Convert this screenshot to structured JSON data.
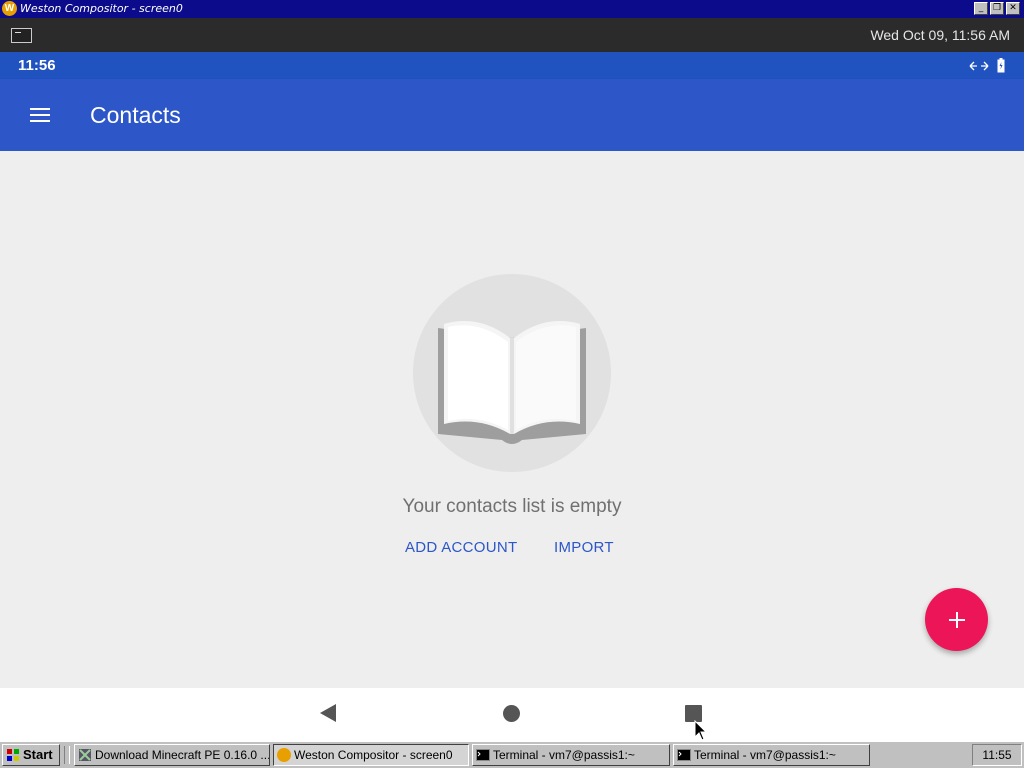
{
  "window": {
    "title": "Weston Compositor - screen0",
    "controls": {
      "minimize": "_",
      "restore": "❐",
      "close": "✕"
    }
  },
  "weston": {
    "clock": "Wed Oct 09, 11:56 AM"
  },
  "status_bar": {
    "time": "11:56"
  },
  "app_bar": {
    "title": "Contacts"
  },
  "content": {
    "empty_message": "Your contacts list is empty",
    "add_account_label": "ADD ACCOUNT",
    "import_label": "IMPORT"
  },
  "taskbar": {
    "start_label": "Start",
    "items": [
      {
        "label": "Download Minecraft PE 0.16.0 ..."
      },
      {
        "label": "Weston Compositor - screen0"
      },
      {
        "label": "Terminal - vm7@passis1:~"
      },
      {
        "label": "Terminal - vm7@passis1:~"
      }
    ],
    "clock": "11:55"
  },
  "colors": {
    "status_bar": "#2052c0",
    "app_bar": "#2d57c8",
    "fab": "#ec1558",
    "accent": "#2d57c8"
  },
  "icons": [
    "weston-icon",
    "terminal-icon",
    "sync-icon",
    "battery-icon",
    "menu-icon",
    "book-icon",
    "plus-icon",
    "back-icon",
    "home-icon",
    "recents-icon",
    "cursor-icon"
  ]
}
